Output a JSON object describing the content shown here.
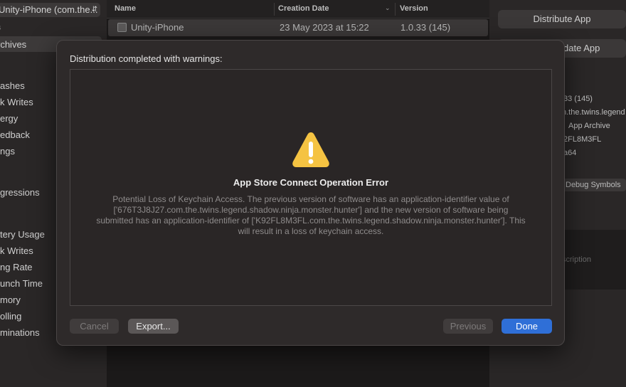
{
  "sidebar": {
    "scheme_label": "Unity-iPhone (com.the...",
    "section_label": "s",
    "items": [
      {
        "label": "rchives"
      },
      {
        "label": "ashes"
      },
      {
        "label": "k Writes"
      },
      {
        "label": "ergy"
      },
      {
        "label": "edback"
      },
      {
        "label": "ngs"
      },
      {
        "label": "gressions"
      },
      {
        "label": "tery Usage"
      },
      {
        "label": "k Writes"
      },
      {
        "label": "ng Rate"
      },
      {
        "label": "unch Time"
      },
      {
        "label": "mory"
      },
      {
        "label": "olling"
      },
      {
        "label": "minations"
      }
    ]
  },
  "archive_list": {
    "columns": {
      "name": "Name",
      "creation_date": "Creation Date",
      "version": "Version"
    },
    "rows": [
      {
        "name": "Unity-iPhone",
        "creation_date": "23 May 2023 at 15:22",
        "version": "1.0.33 (145)"
      }
    ]
  },
  "inspector": {
    "distribute_button": "Distribute App",
    "validate_button": "date App",
    "version": "33 (145)",
    "identifier": "n.the.twins.legend",
    "type": "App Archive",
    "team": "2FL8M3FL",
    "arch": "a64",
    "debug_symbols_button": "Debug Symbols",
    "description_placeholder": "scription"
  },
  "sheet": {
    "title": "Distribution completed with warnings:",
    "error_title": "App Store Connect Operation Error",
    "error_message": "Potential Loss of Keychain Access. The previous version of software has an application-identifier value of ['676T3J8J27.com.the.twins.legend.shadow.ninja.monster.hunter'] and the new version of software being submitted has an application-identifier of ['K92FL8M3FL.com.the.twins.legend.shadow.ninja.monster.hunter']. This will result in a loss of keychain access.",
    "buttons": {
      "cancel": "Cancel",
      "export": "Export...",
      "previous": "Previous",
      "done": "Done"
    }
  },
  "colors": {
    "accent": "#2f6fd7",
    "warning": "#f5c342",
    "sheet_background": "#2e2a2a"
  },
  "icons": {
    "warning": "warning-triangle-icon",
    "chevron": "chevron-updown-icon",
    "sort": "chevron-down-icon",
    "archive": "archive-icon"
  }
}
